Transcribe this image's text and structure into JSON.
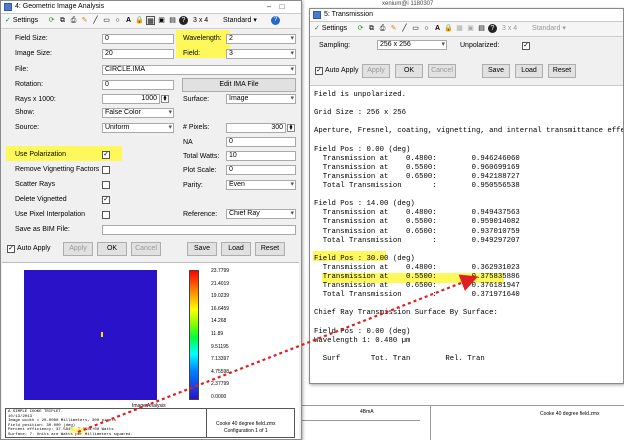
{
  "background": {
    "title_fragment": "xenium@i 1180307",
    "caption_fragment": "Cooke 40 degree field.zmx",
    "scale_label": "4BmA"
  },
  "gia_window": {
    "title": "4: Geometric Image Analysis",
    "toolbar": {
      "settings": "Settings",
      "layout": "3 x 4",
      "standard": "Standard"
    },
    "left": {
      "field_size_label": "Field Size:",
      "field_size_value": "0",
      "image_size_label": "Image Size:",
      "image_size_value": "20",
      "file_label": "File:",
      "file_value": "CIRCLE.IMA",
      "rotation_label": "Rotation:",
      "rotation_value": "0",
      "rays_label": "Rays x 1000:",
      "rays_value": "1000",
      "show_label": "Show:",
      "show_value": "False Color",
      "source_label": "Source:",
      "source_value": "Uniform",
      "use_polarization_label": "Use Polarization",
      "remove_vignetting_label": "Remove Vignetting Factors",
      "scatter_rays_label": "Scatter Rays",
      "delete_vignetted_label": "Delete Vignetted",
      "use_pixel_interp_label": "Use Pixel Interpolation",
      "save_bim_label": "Save as BIM File:"
    },
    "right": {
      "wavelength_label": "Wavelength:",
      "wavelength_value": "2",
      "field_label": "Field:",
      "field_value": "3",
      "edit_ima_label": "Edit IMA File",
      "surface_label": "Surface:",
      "surface_value": "Image",
      "pixels_label": "# Pixels:",
      "pixels_value": "300",
      "na_label": "NA",
      "na_value": "0",
      "total_watts_label": "Total Watts:",
      "total_watts_value": "10",
      "plot_scale_label": "Plot Scale:",
      "plot_scale_value": "0",
      "parity_label": "Parity:",
      "parity_value": "Even",
      "reference_label": "Reference:",
      "reference_value": "Chief Ray"
    },
    "bottom": {
      "auto_apply": "Auto Apply",
      "apply": "Apply",
      "ok": "OK",
      "cancel": "Cancel",
      "save": "Save",
      "load": "Load",
      "reset": "Reset"
    },
    "plot": {
      "colorbar_ticks": [
        "23.7799",
        "21.4019",
        "19.0239",
        "16.6459",
        "14.268",
        "11.89",
        "9.51195",
        "7.13397",
        "4.75598",
        "2.37799",
        "0.0000"
      ],
      "caption": "Image Analysis",
      "info_lines": [
        "A SIMPLE COOKE TRIPLET.",
        "10/13/2013",
        "Image width = 20.0000 Millimeters, 300 pixels",
        "Field position: 30.000 (deg)",
        "Percent efficiency: 37.584%, 3.758E+00 Watts",
        "Surface: 7. Units are Watts per Millimeters squared."
      ],
      "file_name": "Cooke 40 degree field.zmx",
      "config": "Configuration 1 of 1"
    }
  },
  "trans_window": {
    "title": "5: Transmission",
    "toolbar": {
      "settings": "Settings",
      "layout": "3 x 4",
      "standard": "Standard"
    },
    "sampling_label": "Sampling:",
    "sampling_value": "256 x 256",
    "unpolarized_label": "Unpolarized:",
    "buttons": {
      "auto_apply": "Auto Apply",
      "apply": "Apply",
      "ok": "OK",
      "cancel": "Cancel",
      "save": "Save",
      "load": "Load",
      "reset": "Reset"
    },
    "lines": [
      "Field is unpolarized.",
      "",
      "Grid Size : 256 x 256",
      "",
      "Aperture, Fresnel, coating, vignetting, and internal transmittance effects",
      "",
      "Field Pos : 0.00 (deg)",
      "  Transmission at    0.4800:        0.946246060",
      "  Transmission at    0.5500:        0.960699169",
      "  Transmission at    0.6500:        0.942188727",
      "  Total Transmission       :        0.950556538",
      "",
      "Field Pos : 14.00 (deg)",
      "  Transmission at    0.4800:        0.949437563",
      "  Transmission at    0.5500:        0.959014082",
      "  Transmission at    0.6500:        0.937010759",
      "  Total Transmission       :        0.949297207",
      "",
      "Field Pos : 30.00 (deg)",
      "  Transmission at    0.4800:        0.362931023",
      "  Transmission at    0.5500:        0.375835886",
      "  Transmission at    0.6500:        0.376181947",
      "  Total Transmission       :        0.371971640",
      "",
      "Chief Ray Transmission Surface By Surface:",
      "",
      "Field Pos : 0.00 (deg)",
      "Wavelength 1: 0.480 µm",
      "",
      "  Surf       Tot. Tran        Rel. Tran"
    ]
  },
  "colors": {
    "highlight": "#fff85a",
    "arrow": "#e02020",
    "plot_bg": "#2a12c8"
  }
}
